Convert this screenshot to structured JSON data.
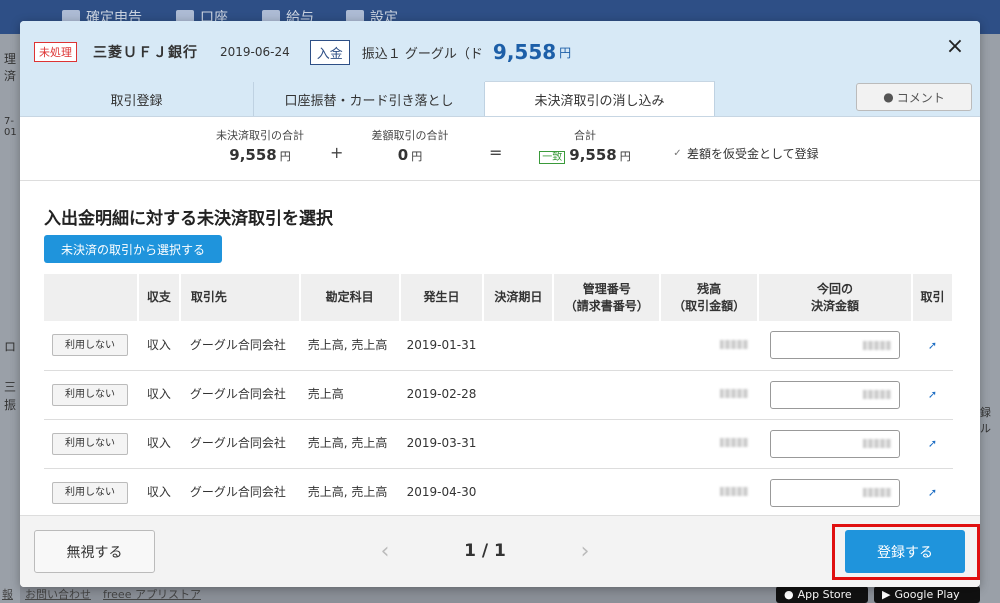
{
  "background": {
    "nav_items": [
      "確定申告",
      "口座",
      "給与",
      "設定"
    ],
    "side_texts": [
      "理済",
      "7-01",
      "ロ",
      "三",
      "振"
    ],
    "right_texts": [
      "録ル"
    ],
    "footer_links": [
      "報",
      "お問い合わせ",
      "freee アプリストア"
    ],
    "app_store": "App Store",
    "google_play": "Google Play"
  },
  "header": {
    "status_badge": "未処理",
    "bank": "三菱ＵＦＪ銀行",
    "date": "2019-06-24",
    "type_badge": "入金",
    "description": "振込１ グーグル（ド",
    "amount": "9,558",
    "yen": "円",
    "close_icon": "×"
  },
  "tabs": [
    {
      "label": "取引登録",
      "active": false
    },
    {
      "label": "口座振替・カード引き落とし",
      "active": false
    },
    {
      "label": "未決済取引の消し込み",
      "active": true
    }
  ],
  "comment_button": "コメント",
  "summary": {
    "unsettled_label": "未決済取引の合計",
    "unsettled_value": "9,558",
    "diff_label": "差額取引の合計",
    "diff_value": "0",
    "total_label": "合計",
    "total_value": "9,558",
    "match_badge": "一致",
    "yen": "円",
    "plus": "+",
    "equals": "=",
    "checkbox_label": "差額を仮受金として登録"
  },
  "section": {
    "title": "入出金明細に対する未決済取引を選択",
    "select_button": "未決済の取引から選択する"
  },
  "table": {
    "headers": [
      "",
      "収支",
      "取引先",
      "勘定科目",
      "発生日",
      "決済期日",
      "管理番号\n（請求書番号）",
      "残高\n（取引金額）",
      "今回の\n決済金額",
      "取引"
    ],
    "rows": [
      {
        "action": "利用しない",
        "type": "収入",
        "partner": "グーグル合同会社",
        "account": "売上高, 売上高",
        "date": "2019-01-31",
        "due": "",
        "ref": ""
      },
      {
        "action": "利用しない",
        "type": "収入",
        "partner": "グーグル合同会社",
        "account": "売上高",
        "date": "2019-02-28",
        "due": "",
        "ref": ""
      },
      {
        "action": "利用しない",
        "type": "収入",
        "partner": "グーグル合同会社",
        "account": "売上高, 売上高",
        "date": "2019-03-31",
        "due": "",
        "ref": ""
      },
      {
        "action": "利用しない",
        "type": "収入",
        "partner": "グーグル合同会社",
        "account": "売上高, 売上高",
        "date": "2019-04-30",
        "due": "",
        "ref": ""
      }
    ]
  },
  "footer": {
    "ignore_button": "無視する",
    "page": "1 / 1",
    "prev_icon": "‹",
    "next_icon": "›",
    "register_button": "登録する"
  }
}
